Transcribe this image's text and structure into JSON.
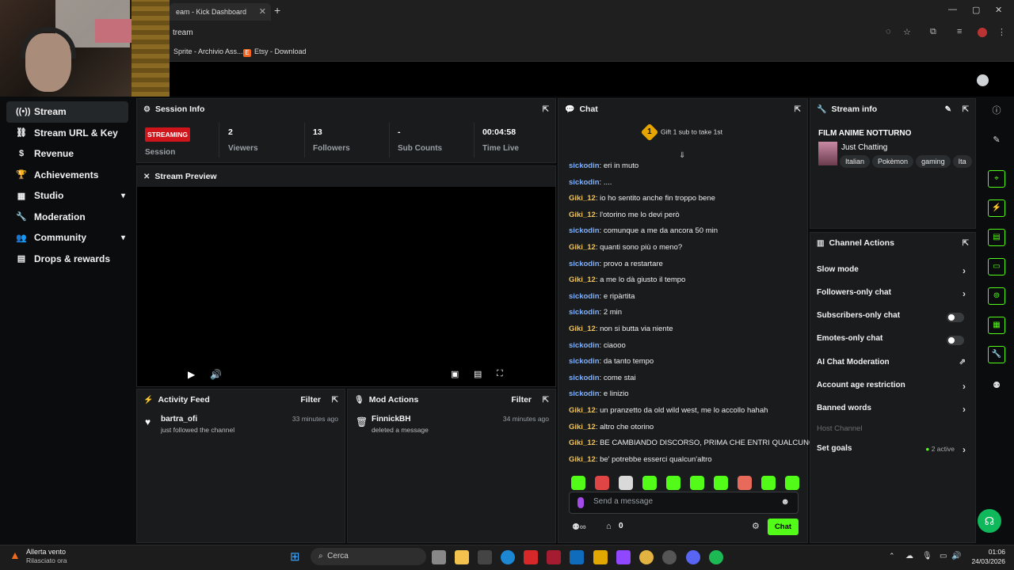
{
  "browser": {
    "tab_title": "eam - Kick Dashboard",
    "tab_close": "✕",
    "new_tab": "+",
    "url": "tream",
    "win_min": "—",
    "win_max": "▢",
    "win_close": "✕",
    "bookmarks": [
      {
        "label": "Sprite - Archivio Ass...",
        "color": "#3b82f6"
      },
      {
        "label": "Etsy - Download",
        "color": "#f1641e",
        "glyph": "E"
      }
    ]
  },
  "sidebar": {
    "items": [
      {
        "label": "Stream",
        "icon": "((•))"
      },
      {
        "label": "Stream URL & Key",
        "icon": "⛓"
      },
      {
        "label": "Revenue",
        "icon": "$"
      },
      {
        "label": "Achievements",
        "icon": "🏆"
      },
      {
        "label": "Studio",
        "icon": "▦"
      },
      {
        "label": "Moderation",
        "icon": "🔧"
      },
      {
        "label": "Community",
        "icon": "👥"
      },
      {
        "label": "Drops & rewards",
        "icon": "▤"
      }
    ]
  },
  "session": {
    "title": "Session Info",
    "badge": "STREAMING",
    "badge_label": "Session",
    "viewers": "2",
    "viewers_label": "Viewers",
    "followers": "13",
    "followers_label": "Followers",
    "subs": "-",
    "subs_label": "Sub Counts",
    "time": "00:04:58",
    "time_label": "Time Live"
  },
  "preview": {
    "title": "Stream Preview"
  },
  "activity": {
    "title": "Activity Feed",
    "filter": "Filter",
    "item": {
      "name": "bartra_ofi",
      "text": "just followed the channel",
      "time": "33 minutes ago"
    }
  },
  "mod": {
    "title": "Mod Actions",
    "filter": "Filter",
    "item": {
      "name": "FinnickBH",
      "text": "deleted a message",
      "time": "34 minutes ago"
    }
  },
  "chat": {
    "title": "Chat",
    "gift_badge": "1",
    "gift_text": "Gift 1 sub to take 1st",
    "user_colors": {
      "sickodin": "#7fb0ff",
      "Giki_12": "#f0c35a"
    },
    "messages": [
      {
        "user": "sickodin",
        "text": ": eri in muto"
      },
      {
        "user": "sickodin",
        "text": ": ...."
      },
      {
        "user": "Giki_12",
        "text": ": io ho sentito anche fin troppo bene"
      },
      {
        "user": "Giki_12",
        "text": ": l'otorino me lo devi però"
      },
      {
        "user": "sickodin",
        "text": ": comunque a me da ancora 50 min"
      },
      {
        "user": "Giki_12",
        "text": ": quanti sono più o meno?"
      },
      {
        "user": "sickodin",
        "text": ": provo a restartare"
      },
      {
        "user": "Giki_12",
        "text": ": a me lo dà giusto il tempo"
      },
      {
        "user": "sickodin",
        "text": ": e ripàrtita"
      },
      {
        "user": "sickodin",
        "text": ": 2 min"
      },
      {
        "user": "Giki_12",
        "text": ": non si butta via niente"
      },
      {
        "user": "sickodin",
        "text": ": ciaooo"
      },
      {
        "user": "sickodin",
        "text": ": da tanto tempo"
      },
      {
        "user": "sickodin",
        "text": ": come stai"
      },
      {
        "user": "sickodin",
        "text": ": e linizio"
      },
      {
        "user": "Giki_12",
        "text": ": un pranzetto da old wild west, me lo accollo hahah"
      },
      {
        "user": "Giki_12",
        "text": ": altro che otorino"
      },
      {
        "user": "Giki_12",
        "text": ": BE CAMBIANDO DISCORSO, PRIMA CHE ENTRI QUALCUNO"
      },
      {
        "user": "Giki_12",
        "text": ": be' potrebbe esserci qualcun'altro"
      }
    ],
    "placeholder": "Send a message",
    "points": "0",
    "send": "Chat"
  },
  "stream_info": {
    "title": "Stream info",
    "stream_title": "FILM ANIME NOTTURNO",
    "category": "Just Chatting",
    "tags": [
      "Italian",
      "Pokèmon",
      "gaming",
      "Ita"
    ]
  },
  "actions": {
    "title": "Channel Actions",
    "slow": "Slow mode",
    "followers": "Followers-only chat",
    "subs": "Subscribers-only chat",
    "emotes": "Emotes-only chat",
    "ai": "AI Chat Moderation",
    "age": "Account age restriction",
    "banned": "Banned words",
    "host": "Host Channel",
    "goals": "Set goals",
    "goals_status": "2 active"
  },
  "taskbar": {
    "weather_title": "Allerta vento",
    "weather_sub": "Rilasciato ora",
    "search": "Cerca",
    "time": "01:06",
    "date": "24/03/2026"
  }
}
